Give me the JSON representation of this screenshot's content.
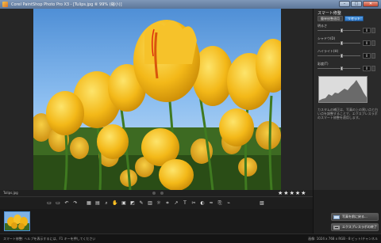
{
  "window": {
    "title": "Corel PaintShop Photo Pro X3 - [Tulips.jpg ⑥ 99% (縮小)]",
    "minimize_glyph": "–",
    "maximize_glyph": "□",
    "close_glyph": "✕"
  },
  "panel": {
    "title": "スマート修整",
    "tabs": [
      {
        "label": "簡単修整適用",
        "active": false
      },
      {
        "label": "リセット",
        "active": true
      }
    ],
    "sliders": [
      {
        "label": "明るさ",
        "value": "0",
        "level": 0.55
      },
      {
        "label": "シャドウ(D)",
        "value": "0",
        "level": 0.55
      },
      {
        "label": "ハイライト(H)",
        "value": "0",
        "level": 0.55
      },
      {
        "label": "彩度(T)",
        "value": "0",
        "level": 0.55
      }
    ],
    "hint": "カスタムの補正は、写真の上の黒い点と白い点を調整することで、エクスプレスラボのスマート修整を適用します。"
  },
  "viewer": {
    "filename": "Tulips.jpg",
    "rating_stars": [
      "★",
      "★",
      "★",
      "★",
      "★"
    ]
  },
  "toolbar": {
    "group1": [
      "▭",
      "▭",
      "↶",
      "↷"
    ],
    "group2": [
      "▦",
      "▤",
      "⌕",
      "✋",
      "▣",
      "◩",
      "✎",
      "▥",
      "☼",
      "⌗",
      "↗",
      "T",
      "✂",
      "◐",
      "≈",
      "⎘",
      "⌁"
    ],
    "group3": [
      "▧"
    ]
  },
  "actions": {
    "open_photo": "写真を前に戻る...",
    "express_lab": "エクスプレスラボの終了"
  },
  "status": {
    "left": "スマート修整: ヘルプを表示するには、F1 キーを押してください",
    "right": "画像: 1024 x 768 x RGB - 8 ビット/チャンネル"
  },
  "colors": {
    "accent": "#3a86d6",
    "sky": "#7fb2e6",
    "tulip": "#f2b416",
    "stem": "#2d5a1e"
  }
}
